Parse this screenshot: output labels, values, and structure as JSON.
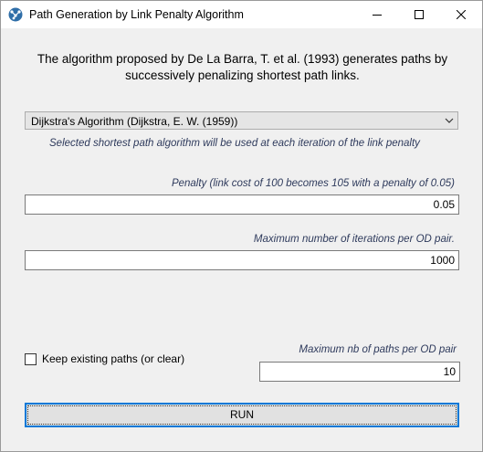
{
  "window": {
    "title": "Path Generation by Link Penalty Algorithm",
    "icon": "network-graph-icon",
    "controls": [
      "minimize-icon",
      "maximize-icon",
      "close-icon"
    ]
  },
  "intro": "The algorithm proposed by De La Barra, T. et al. (1993) generates paths by successively penalizing shortest path links.",
  "algorithm": {
    "selected": "Dijkstra's Algorithm (Dijkstra, E. W. (1959))",
    "hint": "Selected shortest path algorithm will be used at each iteration of the link penalty"
  },
  "penalty": {
    "label": "Penalty (link cost of 100 becomes 105 with a penalty of 0.05)",
    "value": "0.05"
  },
  "iterations": {
    "label": "Maximum number of iterations per OD pair.",
    "value": "1000"
  },
  "keep_paths": {
    "label": "Keep existing paths (or clear)",
    "checked": false
  },
  "max_paths": {
    "label": "Maximum nb of paths per OD pair",
    "value": "10"
  },
  "run_label": "RUN"
}
